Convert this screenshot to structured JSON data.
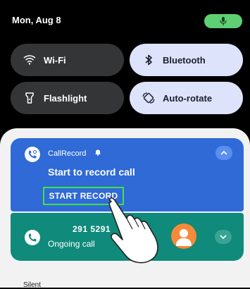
{
  "status": {
    "date": "Mon, Aug 8",
    "mic_icon": "mic-icon",
    "mic_color": "#5fcf74"
  },
  "quick_tiles": [
    {
      "label": "Wi-Fi",
      "icon": "wifi-icon",
      "state": "off"
    },
    {
      "label": "Bluetooth",
      "icon": "bluetooth-icon",
      "state": "on"
    },
    {
      "label": "Flashlight",
      "icon": "flashlight-icon",
      "state": "off"
    },
    {
      "label": "Auto-rotate",
      "icon": "auto-rotate-icon",
      "state": "on"
    }
  ],
  "notification_record": {
    "app_name": "CallRecord",
    "title": "Start to record call",
    "action_label": "START RECORD",
    "color": "#2f6ad6"
  },
  "notification_call": {
    "number": "291 5291",
    "status": "Ongoing call",
    "color": "#0f8a7b"
  },
  "section_label": "Silent"
}
